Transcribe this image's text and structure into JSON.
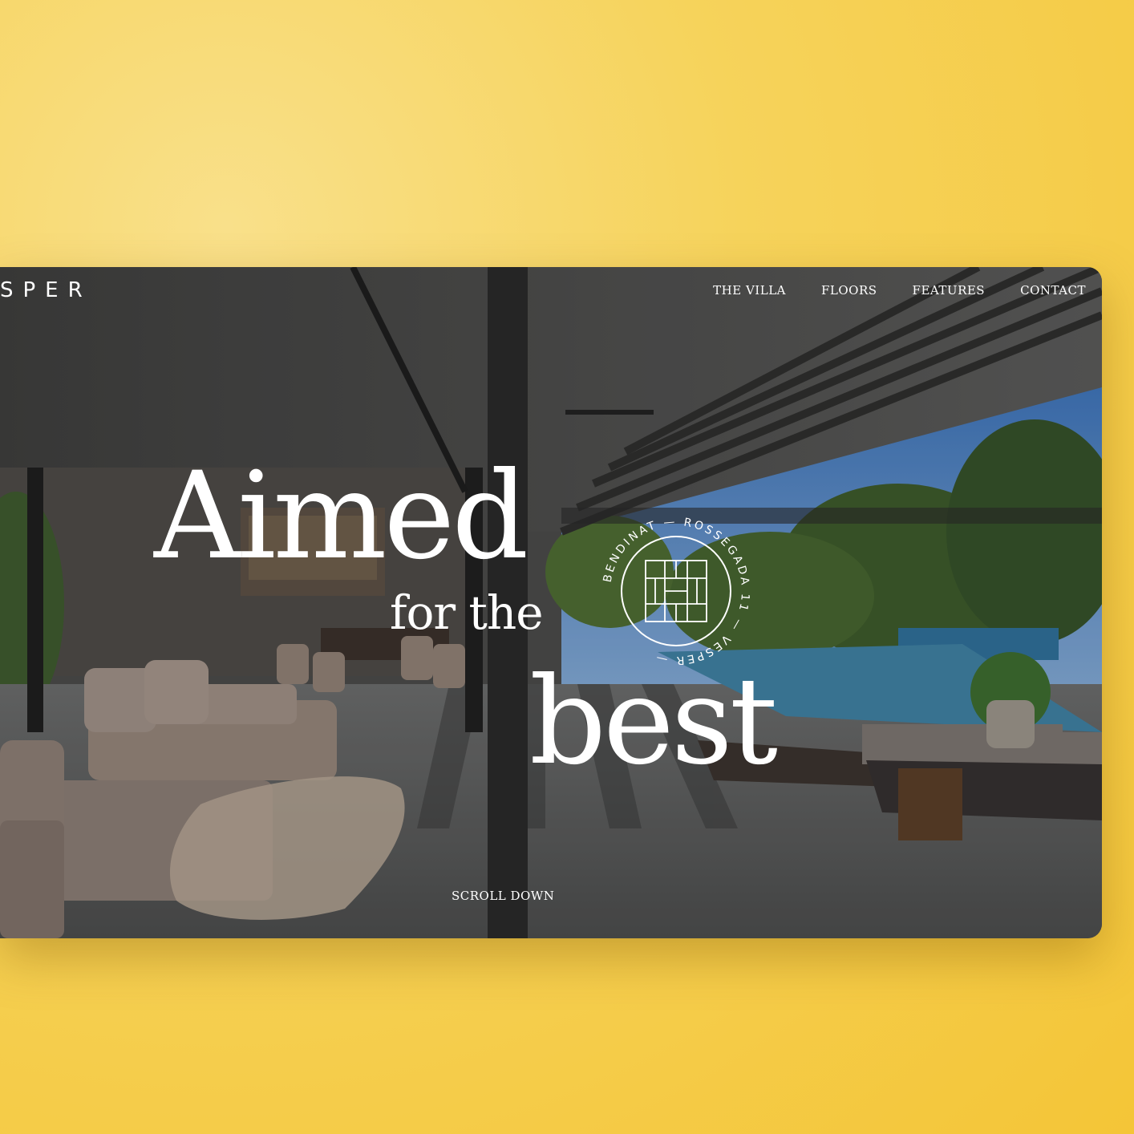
{
  "brand": {
    "logo_text": "SPER"
  },
  "nav": {
    "items": [
      {
        "label": "THE VILLA"
      },
      {
        "label": "FLOORS"
      },
      {
        "label": "FEATURES"
      },
      {
        "label": "CONTACT"
      }
    ]
  },
  "hero": {
    "line1": "Aimed",
    "line2": "for the",
    "line3": "best",
    "seal_text": "BENDINAT — ROSSEGADA 11 — VESPER —",
    "scroll_label": "SCROLL DOWN"
  },
  "colors": {
    "background": "#f6d35b",
    "text": "#ffffff"
  }
}
